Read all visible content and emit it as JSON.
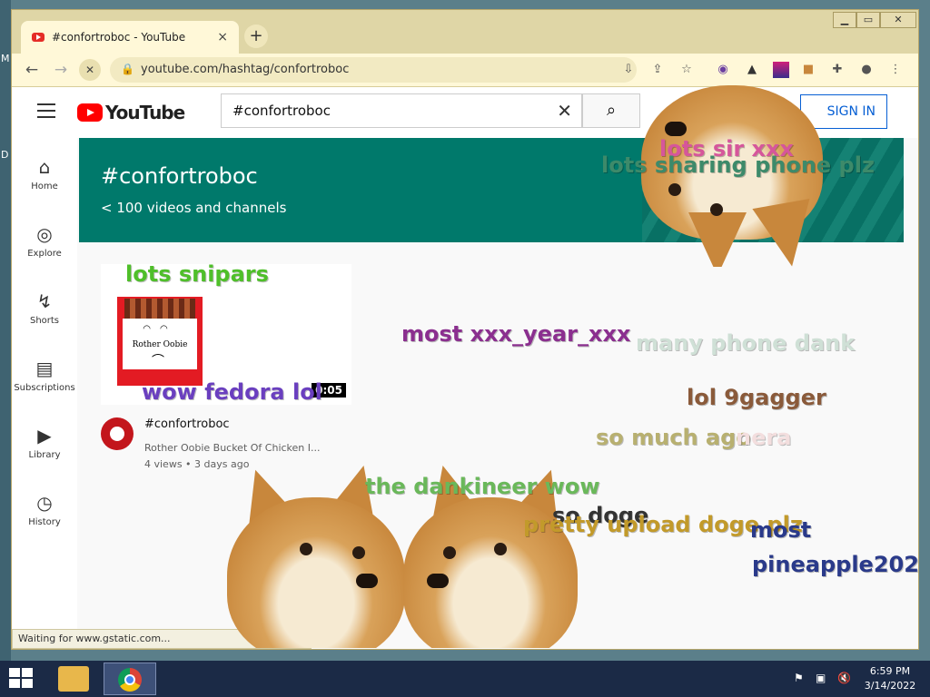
{
  "desktop": {
    "left_glyphs": [
      "M",
      "D"
    ]
  },
  "browser": {
    "tab_title": "#confortroboc - YouTube",
    "tab_close": "×",
    "new_tab": "+",
    "window_controls": [
      "▁",
      "▭",
      "✕"
    ],
    "back": "←",
    "forward": "→",
    "stop": "✕",
    "url": "youtube.com/hashtag/confortroboc",
    "status": "Waiting for www.gstatic.com..."
  },
  "youtube": {
    "logo_text": "YouTube",
    "search_value": "#confortroboc",
    "sign_in": "SIGN IN",
    "nav": [
      {
        "label": "Home",
        "icon": "⌂"
      },
      {
        "label": "Explore",
        "icon": "◎"
      },
      {
        "label": "Shorts",
        "icon": "↯"
      },
      {
        "label": "Subscriptions",
        "icon": "▤"
      },
      {
        "label": "Library",
        "icon": "▶"
      },
      {
        "label": "History",
        "icon": "◷"
      }
    ],
    "banner": {
      "title": "#confortroboc",
      "subtitle": "< 100 videos and channels"
    },
    "video": {
      "duration": "0:05",
      "title": "#confortroboc",
      "channel_line": "Rother Oobie Bucket Of Chicken I...",
      "stats": "4 views • 3 days ago",
      "thumb_brand": "Rother Oobie"
    }
  },
  "overlay_words": [
    {
      "text": "lots sir  xxx",
      "color": "#d6569b"
    },
    {
      "text": "lots sharing phone plz",
      "color": "#3d8a6a"
    },
    {
      "text": "lots snipars",
      "color": "#4fbf2a"
    },
    {
      "text": "most xxx_year_xxx",
      "color": "#8b2f8f"
    },
    {
      "text": "many phone dank",
      "color": "#cfe0d6"
    },
    {
      "text": "wow fedora lol",
      "color": "#6a3fbf"
    },
    {
      "text": "lol 9gagger",
      "color": "#8a5a3a"
    },
    {
      "text": "so much ago",
      "color": "#b8b070"
    },
    {
      "text": "nera",
      "color": "#f3dede"
    },
    {
      "text": "the dankineer wow",
      "color": "#6ab85a"
    },
    {
      "text": "so doge",
      "color": "#333333"
    },
    {
      "text": "pretty upload doge plz",
      "color": "#c29a2a"
    },
    {
      "text": "most",
      "color": "#2a3a8a"
    },
    {
      "text": "pineapple202",
      "color": "#2a3a8a"
    }
  ],
  "taskbar": {
    "clock_time": "6:59 PM",
    "clock_date": "3/14/2022",
    "tray_icons": [
      "flag-icon",
      "network-icon",
      "volume-muted-icon"
    ]
  }
}
